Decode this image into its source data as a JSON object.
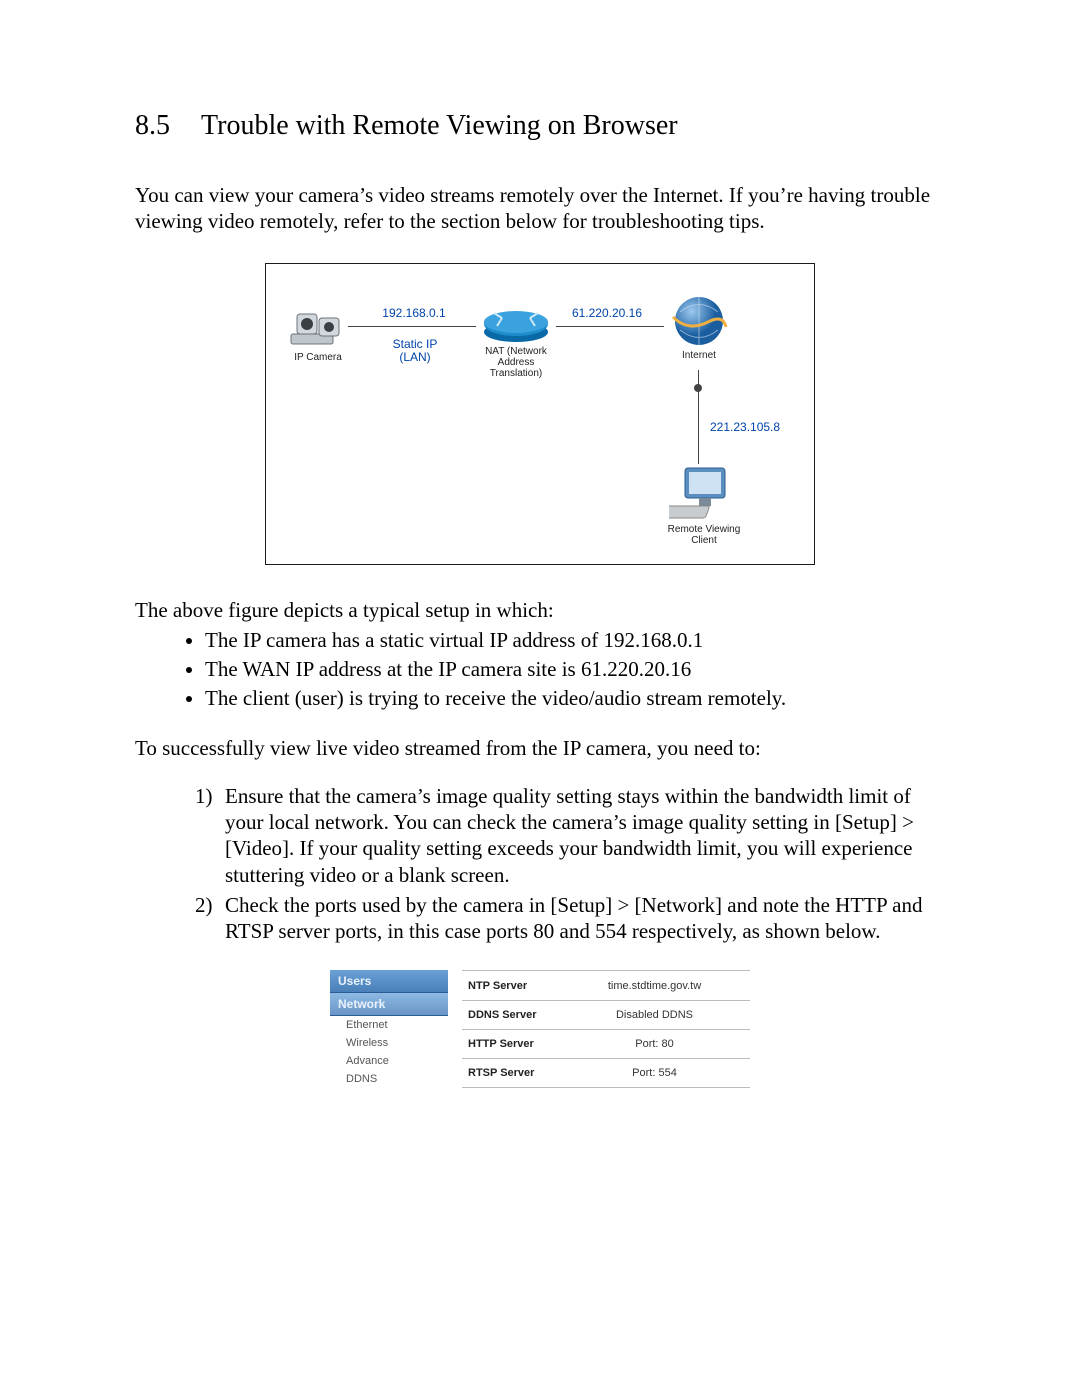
{
  "section": {
    "number": "8.5",
    "title": "Trouble with Remote Viewing on Browser"
  },
  "intro": "You can view your camera’s video streams remotely over the Internet. If you’re having trouble viewing video remotely, refer to the section below for troubleshooting tips.",
  "diagram": {
    "ip_camera_label": "IP Camera",
    "lan_ip": "192.168.0.1",
    "lan_type": "Static IP (LAN)",
    "nat_label": "NAT (Network Address Translation)",
    "wan_ip": "61.220.20.16",
    "internet_label": "Internet",
    "client_ip": "221.23.105.8",
    "client_label": "Remote Viewing Client"
  },
  "after_figure_intro": "The above figure depicts a typical setup in which:",
  "bullets": [
    "The IP camera has a static virtual IP address of 192.168.0.1",
    "The WAN IP address at the IP camera site is 61.220.20.16",
    "The client (user) is trying to receive the video/audio stream remotely."
  ],
  "steps_intro": "To successfully view live video streamed from the IP camera, you need to:",
  "steps": [
    "Ensure that the camera’s image quality setting stays within the bandwidth limit of your local network. You can check the camera’s image quality setting in [Setup] > [Video]. If your quality setting exceeds your bandwidth limit, you will experience stuttering video or a blank screen.",
    "Check the ports used by the camera in [Setup] > [Network] and note the HTTP and RTSP server ports, in this case ports 80 and 554 respectively, as shown below."
  ],
  "ui": {
    "nav": {
      "users": "Users",
      "network": "Network",
      "items": [
        "Ethernet",
        "Wireless",
        "Advance",
        "DDNS"
      ]
    },
    "rows": [
      {
        "label": "NTP Server",
        "value": "time.stdtime.gov.tw"
      },
      {
        "label": "DDNS Server",
        "value": "Disabled DDNS"
      },
      {
        "label": "HTTP Server",
        "value": "Port: 80"
      },
      {
        "label": "RTSP Server",
        "value": "Port: 554"
      }
    ]
  }
}
